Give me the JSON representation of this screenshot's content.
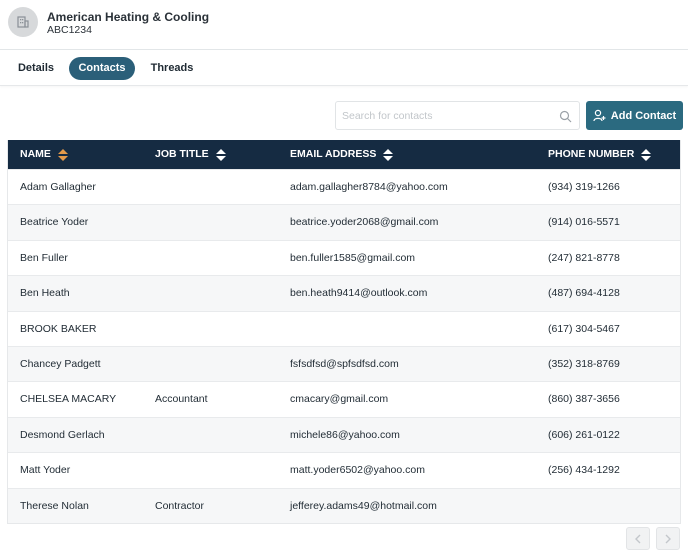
{
  "header": {
    "company_name": "American Heating & Cooling",
    "company_code": "ABC1234"
  },
  "tabs": [
    {
      "label": "Details"
    },
    {
      "label": "Contacts"
    },
    {
      "label": "Threads"
    }
  ],
  "search": {
    "placeholder": "Search for contacts",
    "value": ""
  },
  "toolbar": {
    "add_label": "Add Contact"
  },
  "table": {
    "columns": [
      "NAME",
      "JOB TITLE",
      "EMAIL ADDRESS",
      "PHONE NUMBER"
    ],
    "rows": [
      {
        "name": "Adam Gallagher",
        "job": "",
        "email": "adam.gallagher8784@yahoo.com",
        "phone": "(934) 319-1266"
      },
      {
        "name": "Beatrice Yoder",
        "job": "",
        "email": "beatrice.yoder2068@gmail.com",
        "phone": "(914) 016-5571"
      },
      {
        "name": "Ben Fuller",
        "job": "",
        "email": "ben.fuller1585@gmail.com",
        "phone": "(247) 821-8778"
      },
      {
        "name": "Ben Heath",
        "job": "",
        "email": "ben.heath9414@outlook.com",
        "phone": "(487) 694-4128"
      },
      {
        "name": "BROOK BAKER",
        "job": "",
        "email": "",
        "phone": "(617) 304-5467"
      },
      {
        "name": "Chancey Padgett",
        "job": "",
        "email": "fsfsdfsd@spfsdfsd.com",
        "phone": "(352) 318-8769"
      },
      {
        "name": "CHELSEA MACARY",
        "job": "Accountant",
        "email": "cmacary@gmail.com",
        "phone": "(860) 387-3656"
      },
      {
        "name": "Desmond Gerlach",
        "job": "",
        "email": "michele86@yahoo.com",
        "phone": "(606) 261-0122"
      },
      {
        "name": "Matt Yoder",
        "job": "",
        "email": "matt.yoder6502@yahoo.com",
        "phone": "(256) 434-1292"
      },
      {
        "name": "Therese Nolan",
        "job": "Contractor",
        "email": "jefferey.adams49@hotmail.com",
        "phone": ""
      }
    ]
  },
  "icons": {
    "avatar": "building-icon",
    "search": "search-icon",
    "add": "user-plus-icon",
    "sort": "sort-icon",
    "prev": "chevron-left-icon",
    "next": "chevron-right-icon"
  },
  "colors": {
    "accent": "#2b5f79",
    "header_bg": "#152b42",
    "sort_active": "#e39a4a"
  }
}
